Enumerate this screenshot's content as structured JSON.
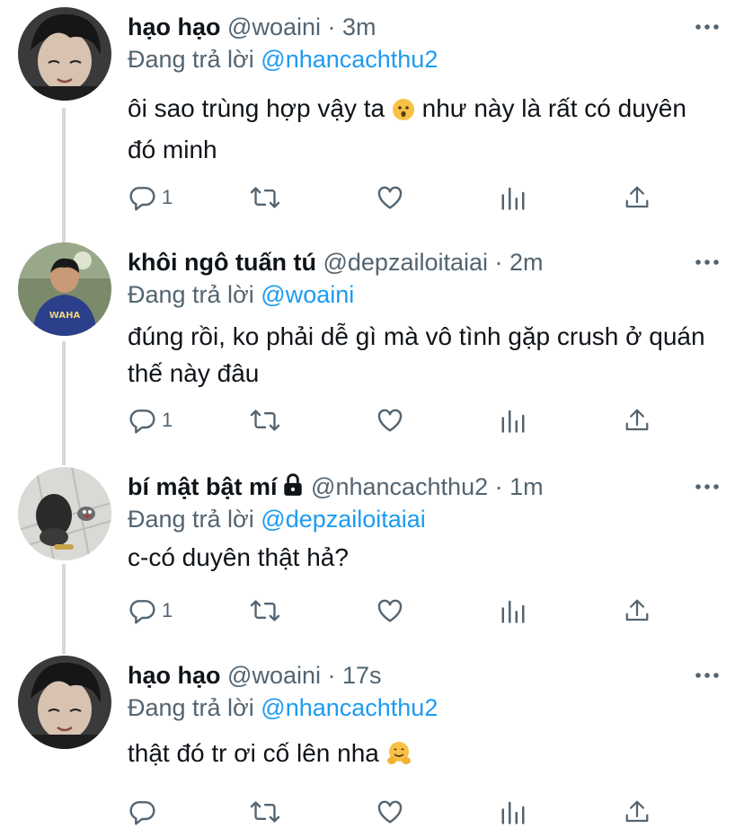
{
  "replying_prefix": "Đang trả lời",
  "tweets": [
    {
      "name": "hạo hạo",
      "handle": "@woaini",
      "separator": "·",
      "time": "3m",
      "reply_to": "@nhancachthu2",
      "text_before_emoji": "ôi sao trùng hợp vậy ta ",
      "emoji": "hushed-face-emoji",
      "text_after_emoji": " như này là rất có duyên đó minh",
      "reply_count": "1",
      "locked": false
    },
    {
      "name": "khôi ngô tuấn tú",
      "handle": "@depzailoitaiai",
      "separator": "·",
      "time": "2m",
      "reply_to": "@woaini",
      "text": "đúng rồi, ko phải dễ gì mà vô tình gặp crush ở quán thế này đâu",
      "reply_count": "1",
      "locked": false
    },
    {
      "name": "bí mật bật mí",
      "handle": "@nhancachthu2",
      "separator": "·",
      "time": "1m",
      "reply_to": "@depzailoitaiai",
      "text": "c-có duyên thật hả?",
      "reply_count": "1",
      "locked": true
    },
    {
      "name": "hạo hạo",
      "handle": "@woaini",
      "separator": "·",
      "time": "17s",
      "reply_to": "@nhancachthu2",
      "text": "thật đó tr ơi cố lên nha ",
      "emoji": "hugging-face-emoji",
      "reply_count": "",
      "locked": false
    }
  ],
  "icons": {
    "reply": "reply-icon",
    "retweet": "retweet-icon",
    "like": "like-icon",
    "analytics": "analytics-icon",
    "share": "share-icon",
    "more": "more-icon",
    "lock": "lock-icon"
  },
  "colors": {
    "text": "#0f1419",
    "secondary": "#536471",
    "mention": "#1d9bf0",
    "thread_line": "#cfd9de"
  }
}
